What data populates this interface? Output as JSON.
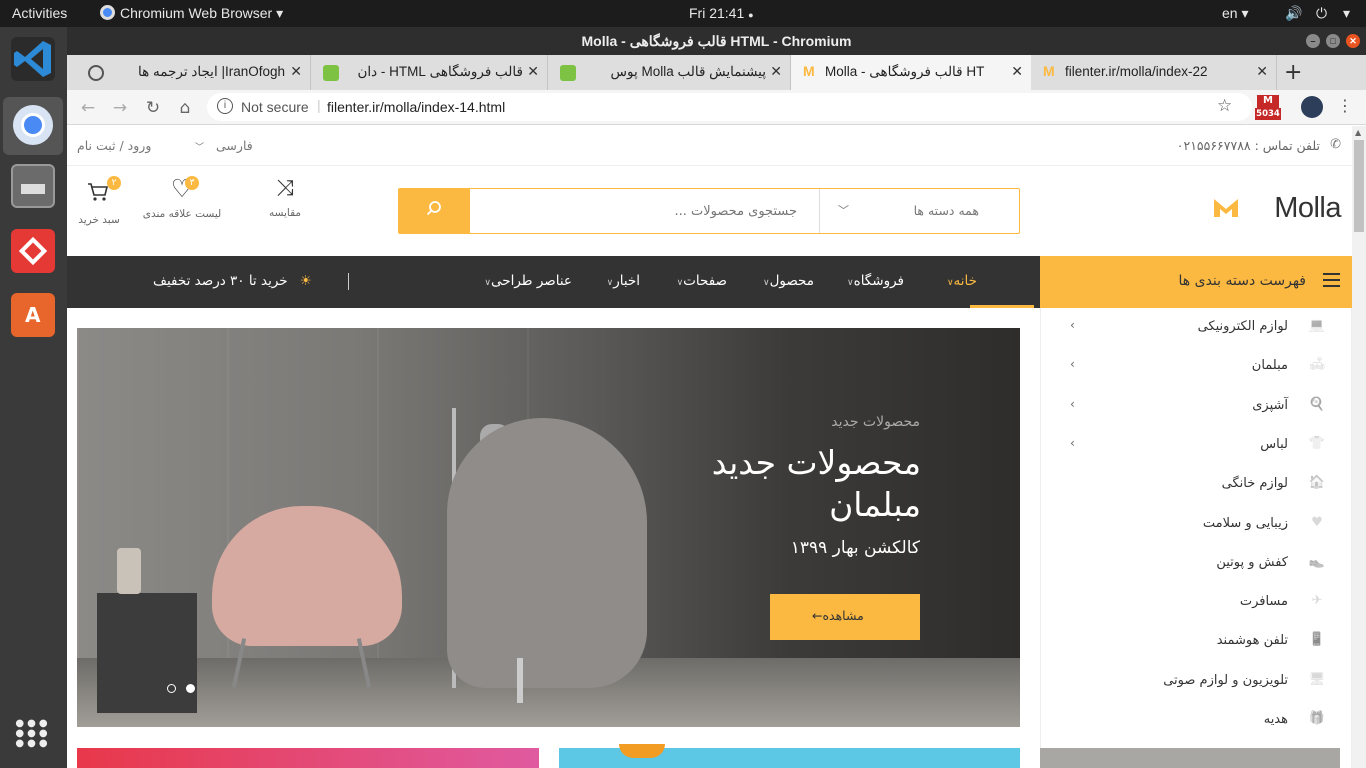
{
  "system": {
    "activities": "Activities",
    "app_name": "Chromium Web Browser",
    "clock": "Fri 21:41",
    "lang": "en"
  },
  "window": {
    "title": "Molla - قالب فروشگاهی HTML - Chromium"
  },
  "tabs": [
    {
      "label": "IranOfogh| ایجاد ترجمه ها"
    },
    {
      "label": "قالب فروشگاهی HTML - دان"
    },
    {
      "label": "پیشنمایش قالب Molla پوس"
    },
    {
      "label": "Molla - قالب فروشگاهی HT"
    },
    {
      "label": "filenter.ir/molla/index-22"
    }
  ],
  "toolbar": {
    "security": "Not secure",
    "url": "filenter.ir/molla/index-14.html",
    "ext_badge": "5034"
  },
  "site": {
    "phone": "تلفن تماس : ۰۲۱۵۵۶۶۷۷۸۸",
    "language": "فارسی",
    "login": "ورود / ثبت نام",
    "logo": "Molla",
    "search_category": "همه دسته ها",
    "search_placeholder": "جستجوی محصولات ...",
    "compare": "مقایسه",
    "wishlist": "لیست علاقه مندی",
    "wishlist_count": "۳",
    "cart": "سبد خرید",
    "cart_count": "۲",
    "categories_title": "فهرست دسته بندی ها",
    "nav": {
      "home": "خانه",
      "shop": "فروشگاه",
      "product": "محصول",
      "pages": "صفحات",
      "news": "اخبار",
      "elements": "عناصر طراحی"
    },
    "promo": "خرید تا ۳۰ درصد تخفیف",
    "categories": [
      {
        "label": "لوازم الکترونیکی"
      },
      {
        "label": "مبلمان"
      },
      {
        "label": "آشپزی"
      },
      {
        "label": "لباس"
      },
      {
        "label": "لوازم خانگی"
      },
      {
        "label": "زیبایی و سلامت"
      },
      {
        "label": "کفش و پوتین"
      },
      {
        "label": "مسافرت"
      },
      {
        "label": "تلفن هوشمند"
      },
      {
        "label": "تلویزیون و لوازم صوتی"
      },
      {
        "label": "هدیه"
      }
    ],
    "hero": {
      "subtitle": "محصولات جدید",
      "title_line1": "محصولات جدید",
      "title_line2": "مبلمان",
      "text": "کالکشن بهار ۱۳۹۹",
      "button": "مشاهده"
    }
  },
  "colors": {
    "accent": "#fcb941",
    "nav_bg": "#333333"
  }
}
